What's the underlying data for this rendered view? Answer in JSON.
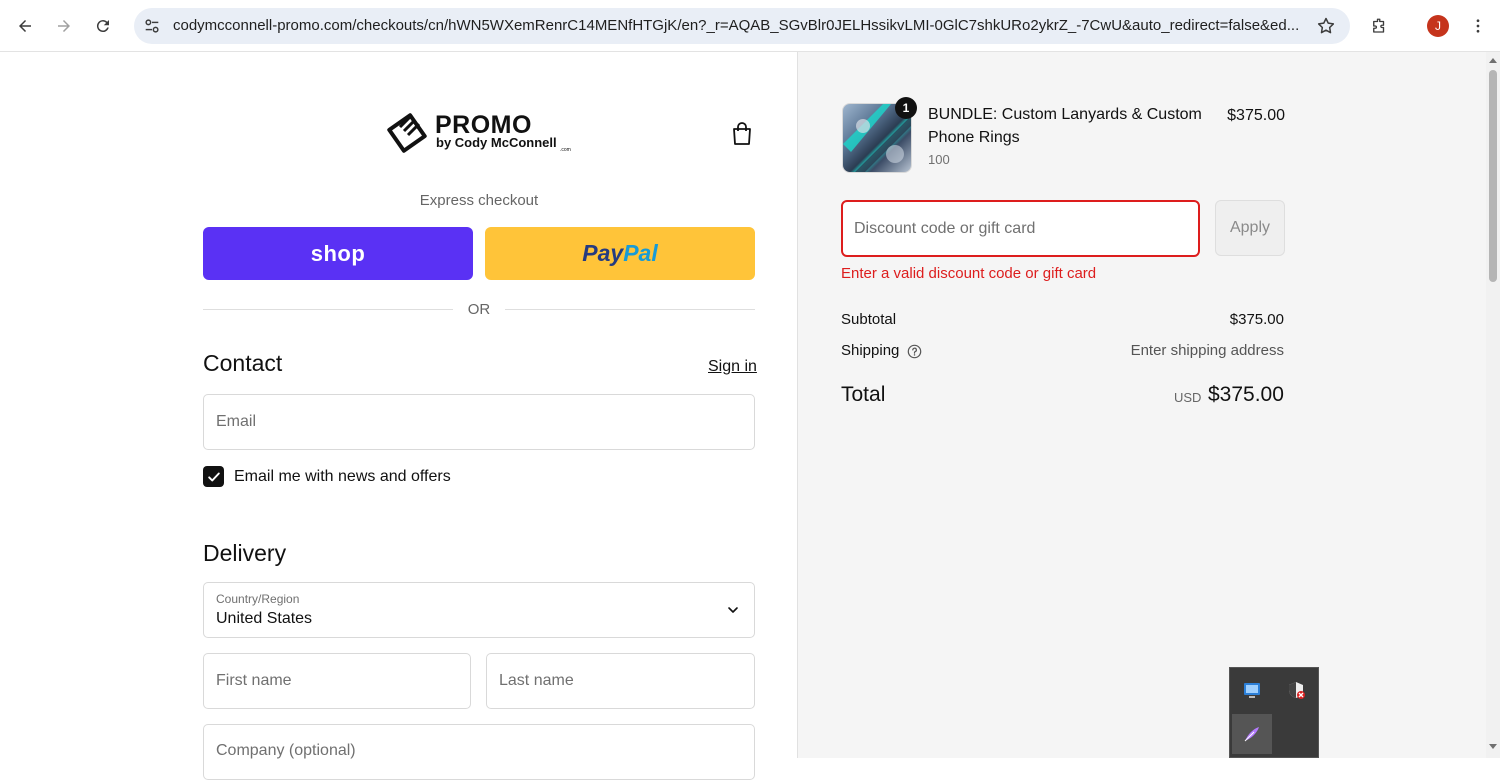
{
  "browser": {
    "url": "codymcconnell-promo.com/checkouts/cn/hWN5WXemRenrC14MENfHTGjK/en?_r=AQAB_SGvBlr0JELHssikvLMI-0GlC7shkURo2ykrZ_-7CwU&auto_redirect=false&ed...",
    "profile_initial": "J",
    "accent_avatar": "#c5341c"
  },
  "header": {
    "logo_title": "PROMO",
    "logo_subtitle": "by Cody McConnell",
    "logo_suffix": ".com"
  },
  "express": {
    "label": "Express checkout",
    "shop_label": "shop",
    "paypal_part1": "Pay",
    "paypal_part2": "Pal",
    "or_label": "OR",
    "shop_color": "#5a31f4",
    "paypal_color": "#ffc439"
  },
  "contact": {
    "heading": "Contact",
    "signin_label": "Sign in",
    "email_placeholder": "Email",
    "newsletter_label": "Email me with news and offers",
    "newsletter_checked": true
  },
  "delivery": {
    "heading": "Delivery",
    "country_label": "Country/Region",
    "country_value": "United States",
    "first_name_placeholder": "First name",
    "last_name_placeholder": "Last name",
    "company_placeholder": "Company (optional)"
  },
  "summary": {
    "item": {
      "quantity": "1",
      "name": "BUNDLE: Custom Lanyards & Custom Phone Rings",
      "variant": "100",
      "price": "$375.00"
    },
    "discount_placeholder": "Discount code or gift card",
    "apply_label": "Apply",
    "error_message": "Enter a valid discount code or gift card",
    "error_color": "#dd1d1d",
    "subtotal_label": "Subtotal",
    "subtotal_value": "$375.00",
    "shipping_label": "Shipping",
    "shipping_value": "Enter shipping address",
    "total_label": "Total",
    "currency": "USD",
    "total_value": "$375.00"
  }
}
